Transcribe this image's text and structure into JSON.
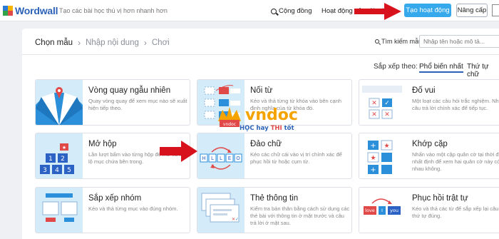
{
  "header": {
    "logo_text": "Wordwall",
    "tagline": "Tạo các bài học thú vị hơn nhanh hơn",
    "nav_community": "Cộng đồng",
    "nav_activities": "Hoạt động của tôi",
    "nav_cut": "K",
    "create_button": "Tạo hoạt động",
    "upgrade_button": "Nâng cấp"
  },
  "breadcrumb": {
    "step1": "Chọn mẫu",
    "step2": "Nhập nội dung",
    "step3": "Chơi"
  },
  "template_search": {
    "label": "Tìm kiếm mẫu:",
    "placeholder": "Nhập tên hoặc mô tả..."
  },
  "sort": {
    "label": "Sắp xếp theo:",
    "popular": "Phổ biến nhất",
    "alphabetical": "Thứ tự chữ"
  },
  "templates": [
    {
      "title": "Vòng quay ngẫu nhiên",
      "desc": "Quay vòng quay để xem mục nào sẽ xuất hiện tiếp theo."
    },
    {
      "title": "Nối từ",
      "desc": "Kéo và thả từng từ khóa vào bên cạnh định nghĩa của từ khóa đó."
    },
    {
      "title": "Đố vui",
      "desc": "Một loạt các câu hỏi trắc nghiệm. Nhấn vào câu trả lời chính xác để tiếp tục."
    },
    {
      "title": "Mở hộp",
      "desc": "Lần lượt bấm vào từng hộp để mở và làm lộ mục chứa bên trong."
    },
    {
      "title": "Đảo chữ",
      "desc": "Kéo các chữ cái vào vị trí chính xác để phục hồi từ hoặc cụm từ."
    },
    {
      "title": "Khớp cặp",
      "desc": "Nhấn vào một cặp quân cờ tại thời điểm nhất định để xem hai quân cờ này có khớp nhau không."
    },
    {
      "title": "Sắp xếp nhóm",
      "desc": "Kéo và thả từng mục vào đúng nhóm."
    },
    {
      "title": "Thẻ thông tin",
      "desc": "Kiểm tra bản thân bằng cách sử dụng các thẻ bài với thông tin ở mặt trước và câu trả lời ở mặt sau."
    },
    {
      "title": "Phục hồi trật tự",
      "desc": "Kéo và thả các từ để sắp xếp lại câu theo thứ tự đúng."
    }
  ],
  "thumbs": {
    "open_box_numbers": [
      "1",
      "2",
      "3",
      "4",
      "5"
    ],
    "anagram_letters": [
      "H",
      "L",
      "L",
      "E",
      "O"
    ],
    "unjumble_words": [
      "love",
      "I",
      "you"
    ]
  },
  "watermark": {
    "brand": "vndoc",
    "slogan_prefix": "HỌC hay ",
    "slogan_thi": "THI",
    "slogan_suffix": " tốt"
  },
  "colors": {
    "primary": "#36a8ec",
    "thumb_bg": "#d4ebfa",
    "arrow_red": "#d8121d",
    "link_underline": "#2c62b8"
  }
}
